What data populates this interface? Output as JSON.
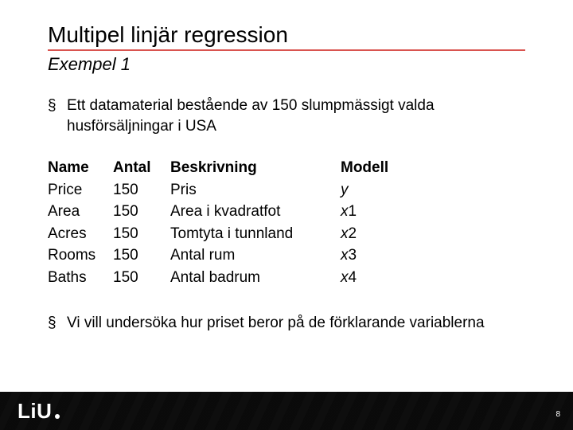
{
  "title": "Multipel linjär regression",
  "subtitle": "Exempel 1",
  "bullets": {
    "b1": "Ett datamaterial bestående av 150 slumpmässigt valda husförsäljningar i USA",
    "b2": "Vi vill undersöka hur priset beror på de förklarande variablerna"
  },
  "table": {
    "headers": {
      "name": "Name",
      "antal": "Antal",
      "besk": "Beskrivning",
      "modell": "Modell"
    },
    "rows": [
      {
        "name": "Price",
        "antal": "150",
        "besk": "Pris",
        "modell_var": "y",
        "modell_idx": ""
      },
      {
        "name": "Area",
        "antal": "150",
        "besk": "Area i kvadratfot",
        "modell_var": "x",
        "modell_idx": "1"
      },
      {
        "name": "Acres",
        "antal": "150",
        "besk": "Tomtyta i tunnland",
        "modell_var": "x",
        "modell_idx": "2"
      },
      {
        "name": "Rooms",
        "antal": "150",
        "besk": "Antal rum",
        "modell_var": "x",
        "modell_idx": "3"
      },
      {
        "name": "Baths",
        "antal": "150",
        "besk": "Antal badrum",
        "modell_var": "x",
        "modell_idx": "4"
      }
    ]
  },
  "footer": {
    "logo": "LiU",
    "page": "8"
  }
}
